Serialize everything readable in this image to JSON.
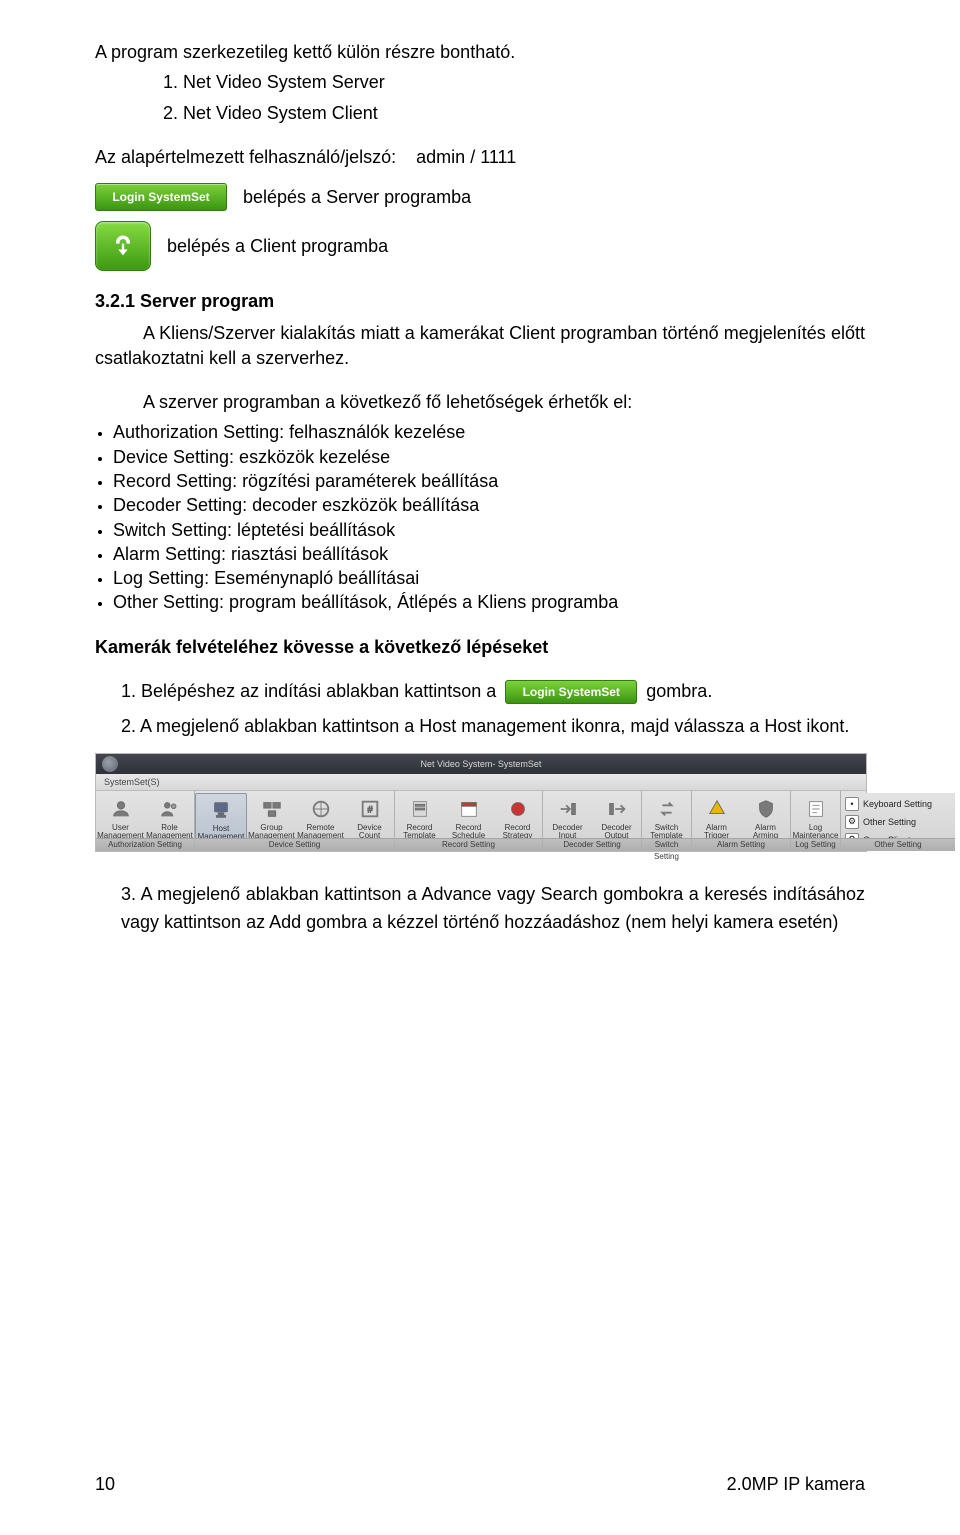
{
  "intro": {
    "title_line": "A program szerkezetileg kettő külön részre bontható.",
    "item1": "1. Net Video System Server",
    "item2": "2. Net Video System Client",
    "default_creds_label": "Az alapértelmezett felhasználó/jelszó:    admin / 1111",
    "login_caption": "belépés a Server programba",
    "client_caption": "belépés a Client programba"
  },
  "section": {
    "number": "3.2.1 Server program",
    "para1": "A Kliens/Szerver kialakítás miatt a kamerákat Client programban történő megjelenítés előtt csatlakoztatni kell a szerverhez.",
    "para2": "A szerver programban a következő fő lehetőségek érhetők el:"
  },
  "features": [
    "Authorization Setting: felhasználók kezelése",
    "Device Setting: eszközök kezelése",
    "Record Setting: rögzítési paraméterek beállítása",
    "Decoder Setting: decoder eszközök beállítása",
    "Switch Setting: léptetési beállítások",
    "Alarm Setting: riasztási beállítások",
    "Log Setting: Eseménynapló beállításai",
    "Other Setting: program beállítások, Átlépés a Kliens programba"
  ],
  "steps": {
    "heading": "Kamerák felvételéhez kövesse a következő lépéseket",
    "s1a": "1.  Belépéshez az indítási ablakban kattintson a",
    "s1b": " gombra.",
    "s2": "2.  A megjelenő ablakban kattintson a Host management ikonra, majd válassza a Host ikont.",
    "s3": "3.  A megjelenő ablakban kattintson a Advance vagy Search gombokra a keresés indításához vagy kattintson az Add gombra a kézzel történő hozzáadáshoz (nem helyi kamera esetén)"
  },
  "login_button_text": "Login SystemSet",
  "toolbar": {
    "window_title": "Net Video System- SystemSet",
    "menu": "SystemSet(S)",
    "groups": [
      {
        "label": "Authorization Setting",
        "items": [
          {
            "name": "user-management",
            "l1": "User",
            "l2": "Management"
          },
          {
            "name": "role-management",
            "l1": "Role",
            "l2": "Management"
          }
        ]
      },
      {
        "label": "Device Setting",
        "items": [
          {
            "name": "host-management",
            "l1": "Host",
            "l2": "Management",
            "selected": true
          },
          {
            "name": "group-management",
            "l1": "Group",
            "l2": "Management"
          },
          {
            "name": "remote-management",
            "l1": "Remote",
            "l2": "Management"
          },
          {
            "name": "device-count",
            "l1": "Device",
            "l2": "Count"
          }
        ]
      },
      {
        "label": "Record Setting",
        "items": [
          {
            "name": "record-template",
            "l1": "Record",
            "l2": "Template"
          },
          {
            "name": "record-schedule",
            "l1": "Record",
            "l2": "Schedule"
          },
          {
            "name": "record-strategy",
            "l1": "Record",
            "l2": "Strategy"
          }
        ]
      },
      {
        "label": "Decoder Setting",
        "items": [
          {
            "name": "decoder-input",
            "l1": "Decoder",
            "l2": "Input"
          },
          {
            "name": "decoder-output",
            "l1": "Decoder",
            "l2": "Output"
          }
        ]
      },
      {
        "label": "Switch Setting",
        "items": [
          {
            "name": "switch-template",
            "l1": "Switch",
            "l2": "Template"
          }
        ]
      },
      {
        "label": "Alarm Setting",
        "items": [
          {
            "name": "alarm-trigger",
            "l1": "Alarm",
            "l2": "Trigger"
          },
          {
            "name": "alarm-arming",
            "l1": "Alarm",
            "l2": "Arming"
          }
        ]
      },
      {
        "label": "Log Setting",
        "items": [
          {
            "name": "log-maintenance",
            "l1": "Log",
            "l2": "Maintenance"
          }
        ]
      }
    ],
    "side_label": "Other Setting",
    "side": [
      "Keyboard Setting",
      "Other Setting",
      "Open Client"
    ]
  },
  "footer": {
    "page": "10",
    "title": "2.0MP IP kamera"
  }
}
